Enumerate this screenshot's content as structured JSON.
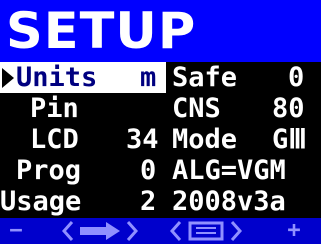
{
  "title": "SETUP",
  "rows": [
    {
      "left_label": "Units",
      "left_value": "m",
      "right_label": "Safe",
      "right_value": "0"
    },
    {
      "left_label": "Pin",
      "left_value": "",
      "right_label": "CNS",
      "right_value": "80"
    },
    {
      "left_label": "LCD",
      "left_value": "34",
      "right_label": "Mode",
      "right_value": "GⅢ"
    },
    {
      "left_label": "Prog",
      "left_value": "0",
      "right_label": "ALG=VGM",
      "right_value": ""
    },
    {
      "left_label": "Usage",
      "left_value": "2",
      "right_label": "2008v3a",
      "right_value": ""
    }
  ],
  "footer": {
    "minus_label": "−",
    "plus_label": "+",
    "next_icon": "next-arrow-icon",
    "menu_icon": "menu-icon"
  },
  "colors": {
    "title_bg": "#0000ff",
    "footer_bg": "#0000cc",
    "text": "#ffffff",
    "background": "#000000"
  }
}
